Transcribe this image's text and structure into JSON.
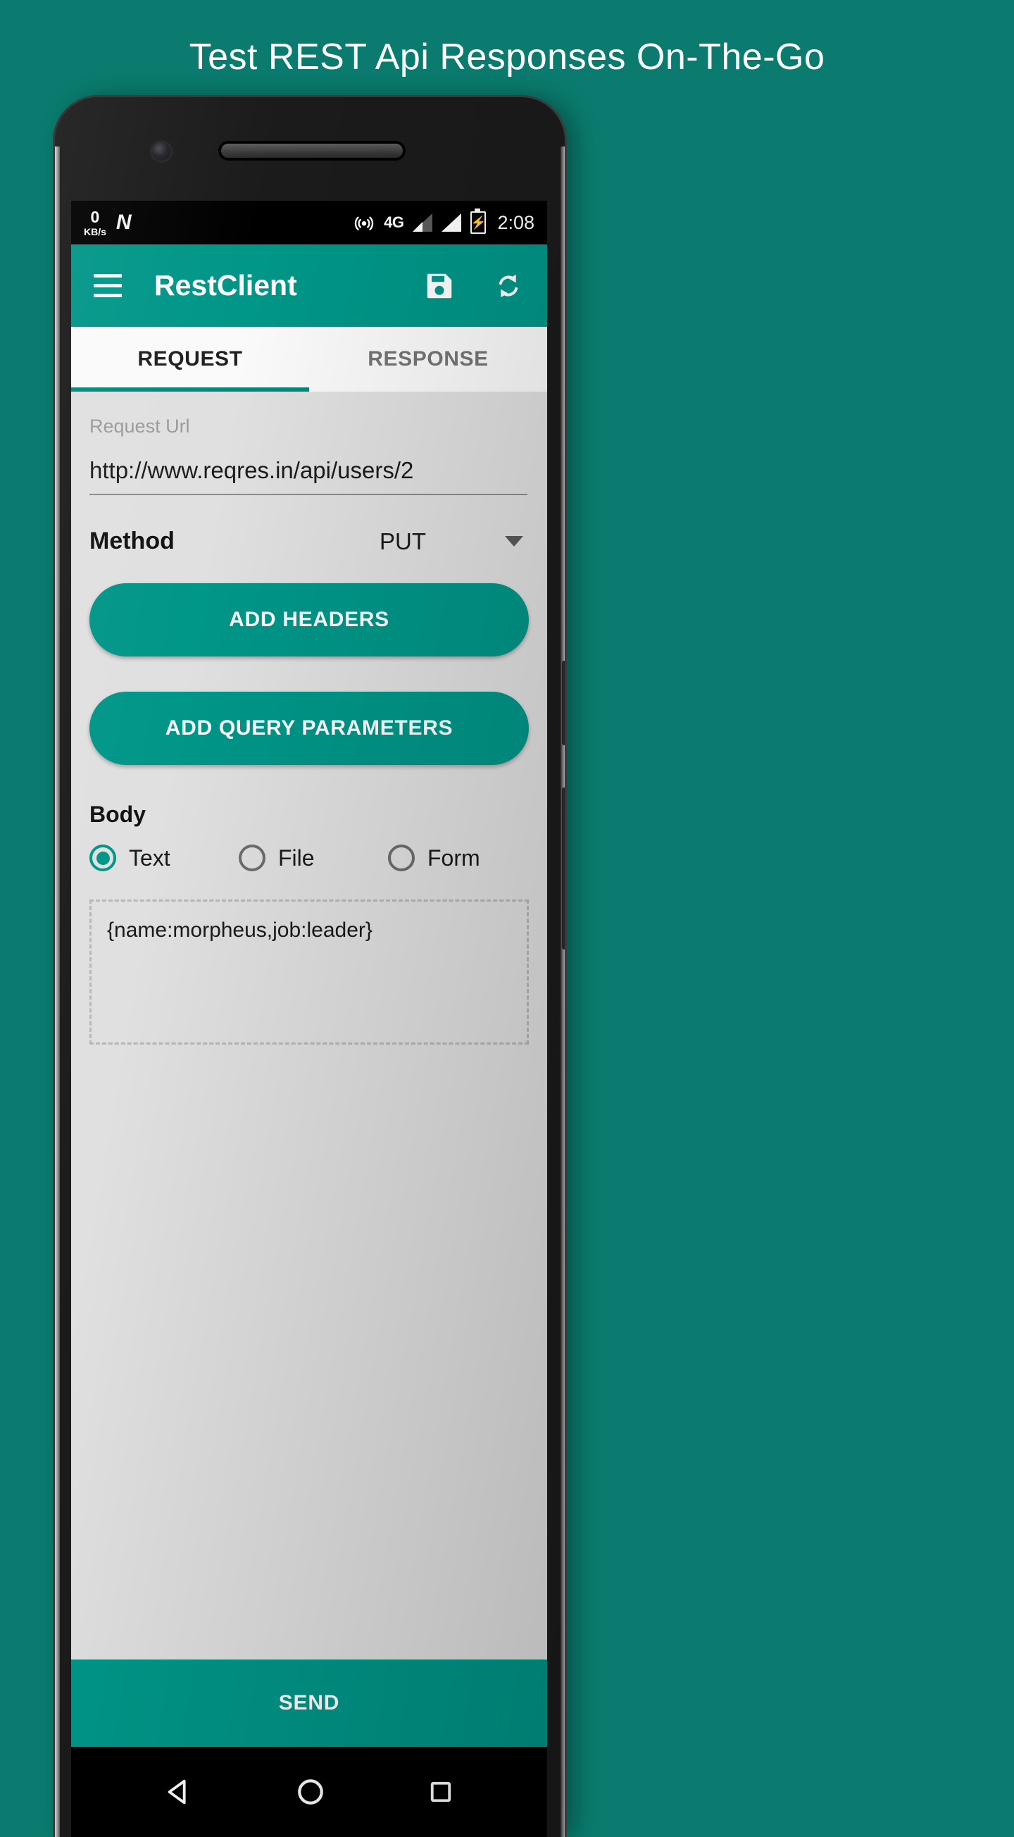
{
  "promo": {
    "headline": "Test REST Api Responses On-The-Go"
  },
  "colors": {
    "background": "#0a7b6e",
    "accent": "#009688",
    "tab_indicator": "#00897b",
    "screen_bg": "#e0e0e0"
  },
  "status_bar": {
    "net_speed_value": "0",
    "net_speed_unit": "KB/s",
    "os_badge": "N",
    "network_type": "4G",
    "time": "2:08",
    "icons": [
      "hotspot-icon",
      "signal-icon-sim1",
      "signal-icon-sim2",
      "battery-charging-icon"
    ]
  },
  "app_bar": {
    "title": "RestClient",
    "menu_icon": "hamburger-menu-icon",
    "actions": [
      {
        "name": "save-icon"
      },
      {
        "name": "refresh-icon"
      }
    ]
  },
  "tabs": [
    {
      "label": "REQUEST",
      "active": true
    },
    {
      "label": "RESPONSE",
      "active": false
    }
  ],
  "request": {
    "url_label": "Request Url",
    "url_value": "http://www.reqres.in/api/users/2",
    "method_label": "Method",
    "method_value": "PUT",
    "add_headers_label": "ADD HEADERS",
    "add_query_parameters_label": "ADD QUERY PARAMETERS",
    "body_label": "Body",
    "body_types": [
      {
        "label": "Text",
        "selected": true
      },
      {
        "label": "File",
        "selected": false
      },
      {
        "label": "Form",
        "selected": false
      }
    ],
    "body_value": "{name:morpheus,job:leader}",
    "send_label": "SEND"
  },
  "nav_bar": {
    "back": "back-triangle-icon",
    "home": "home-circle-icon",
    "recents": "recents-square-icon"
  }
}
